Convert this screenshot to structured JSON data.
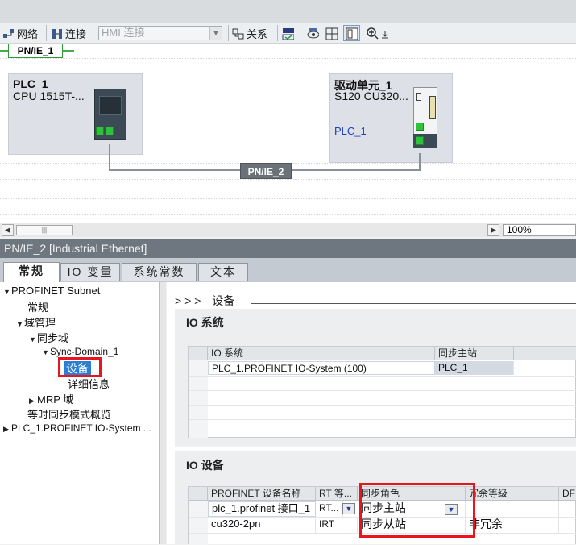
{
  "toolbar": {
    "network_label": "网络",
    "connect_label": "连接",
    "hmi_connection": "HMI 连接",
    "relations_label": "关系"
  },
  "network": {
    "subnet_top": "PN/IE_1",
    "subnet_link": "PN/IE_2",
    "devices": [
      {
        "name": "PLC_1",
        "type": "CPU 1515T-..."
      },
      {
        "name": "驱动单元_1",
        "type": "S120 CU320...",
        "link": "PLC_1"
      }
    ],
    "zoom": "100%"
  },
  "inspector": {
    "header": "PN/IE_2 [Industrial Ethernet]",
    "tabs": [
      "常规",
      "IO 变量",
      "系统常数",
      "文本"
    ],
    "active_tab": "常规"
  },
  "tree": {
    "items": [
      {
        "label": "PROFINET Subnet"
      },
      {
        "label": "常规"
      },
      {
        "label": "域管理"
      },
      {
        "label": "同步域"
      },
      {
        "label": "Sync-Domain_1"
      },
      {
        "label": "设备"
      },
      {
        "label": "详细信息"
      },
      {
        "label": "MRP 域"
      },
      {
        "label": "等时同步模式概览"
      },
      {
        "label": "PLC_1.PROFINET IO-System ..."
      }
    ]
  },
  "content": {
    "breadcrumb_prefix": "> > >",
    "breadcrumb": "设备",
    "io_system_section": {
      "title": "IO 系统",
      "columns": [
        "IO 系统",
        "同步主站"
      ],
      "rows": [
        [
          "PLC_1.PROFINET IO-System (100)",
          "PLC_1"
        ]
      ]
    },
    "io_device_section": {
      "title": "IO 设备",
      "columns": [
        "PROFINET 设备名称",
        "RT 等...",
        "同步角色",
        "冗余等级",
        "DFP"
      ],
      "rows": [
        [
          "plc_1.profinet 接口_1",
          "RT...",
          "同步主站",
          ""
        ],
        [
          "cu320-2pn",
          "IRT",
          "同步从站",
          "非冗余"
        ]
      ]
    }
  }
}
